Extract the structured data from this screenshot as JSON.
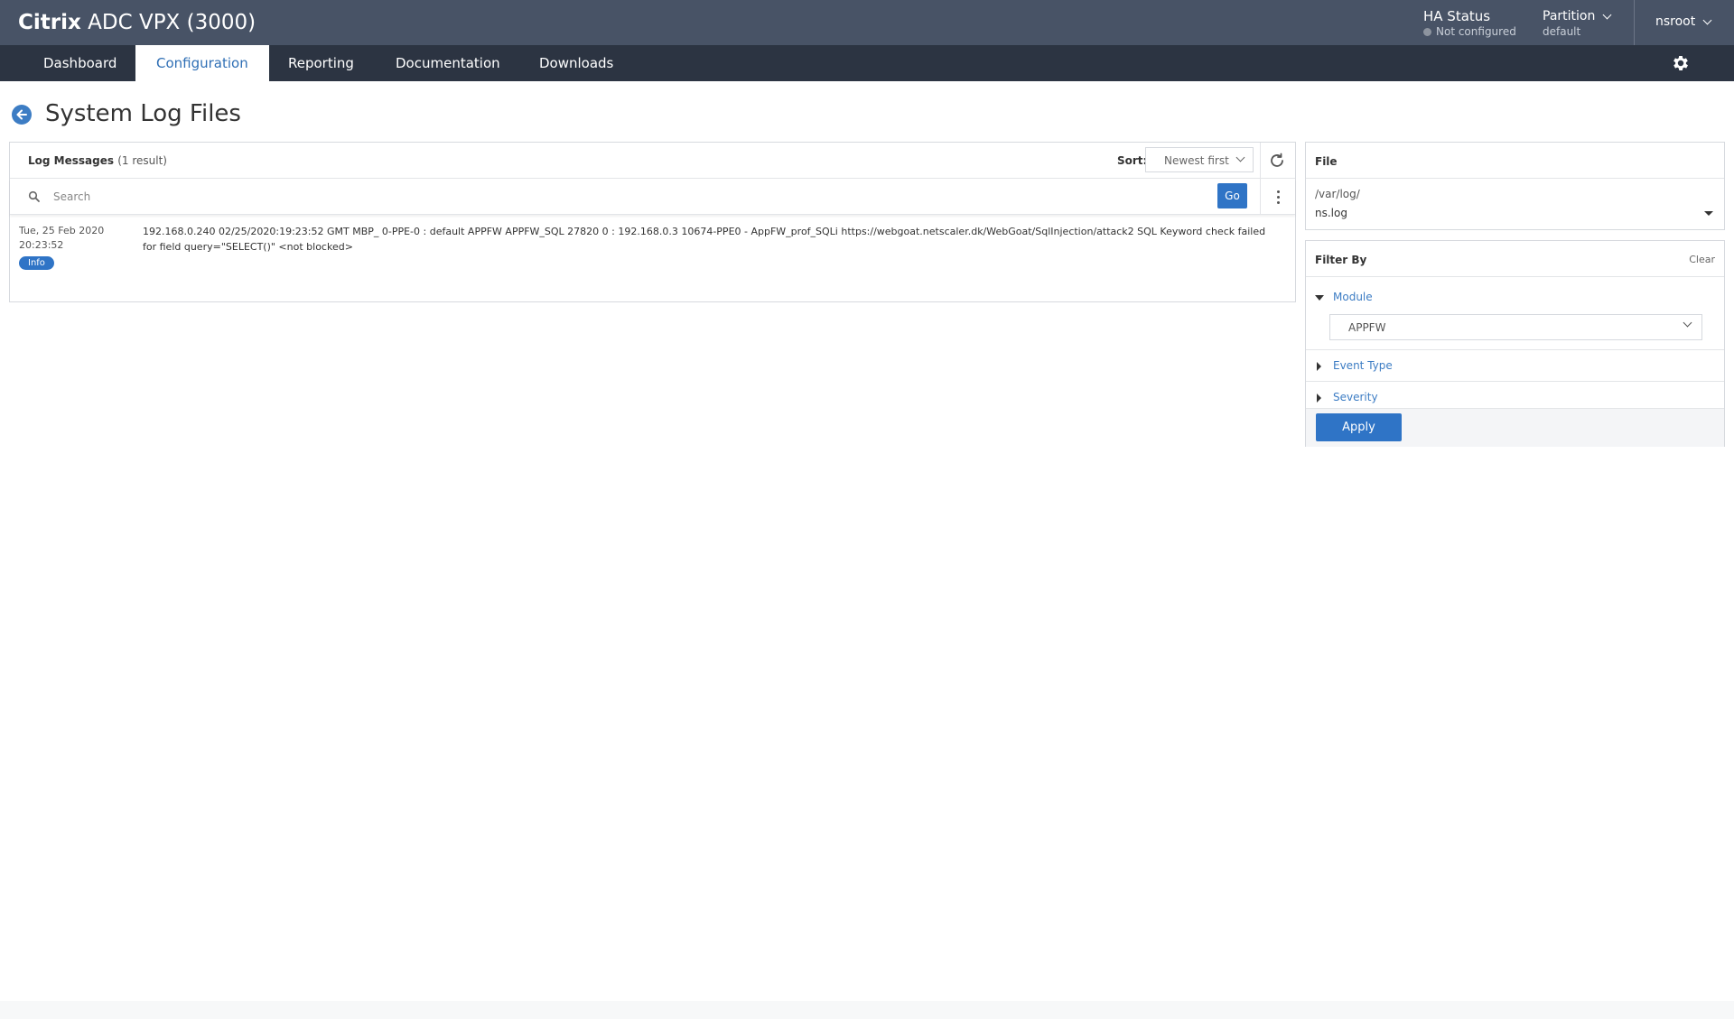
{
  "header": {
    "brand_bold": "Citrix",
    "brand_rest": " ADC VPX (3000)",
    "ha_status_label": "HA Status",
    "ha_status_value": "Not configured",
    "partition_label": "Partition",
    "partition_value": "default",
    "user": "nsroot"
  },
  "nav": {
    "tabs": [
      {
        "label": "Dashboard"
      },
      {
        "label": "Configuration"
      },
      {
        "label": "Reporting"
      },
      {
        "label": "Documentation"
      },
      {
        "label": "Downloads"
      }
    ],
    "active_tab": "Configuration"
  },
  "page": {
    "title": "System Log Files"
  },
  "log_panel": {
    "title": "Log Messages",
    "result_count": "(1 result)",
    "sort_label": "Sort:",
    "sort_value": "Newest first",
    "search_placeholder": "Search",
    "go_label": "Go",
    "rows": [
      {
        "date": "Tue, 25 Feb 2020",
        "time": "20:23:52",
        "severity": "Info",
        "message": "192.168.0.240 02/25/2020:19:23:52 GMT MBP_ 0-PPE-0 : default APPFW APPFW_SQL 27820 0 : 192.168.0.3 10674-PPE0 - AppFW_prof_SQLi https://webgoat.netscaler.dk/WebGoat/SqlInjection/attack2 SQL Keyword check failed for field query=\"SELECT()\" <not blocked>"
      }
    ]
  },
  "file_panel": {
    "title": "File",
    "path": "/var/log/",
    "file": "ns.log"
  },
  "filter_panel": {
    "title": "Filter By",
    "clear_label": "Clear",
    "module_label": "Module",
    "module_value": "APPFW",
    "event_type_label": "Event Type",
    "severity_label": "Severity",
    "apply_label": "Apply"
  },
  "colors": {
    "header_bg": "#485366",
    "nav_bg": "#2c3442",
    "accent": "#2f74c6",
    "link": "#3d7dc4"
  }
}
